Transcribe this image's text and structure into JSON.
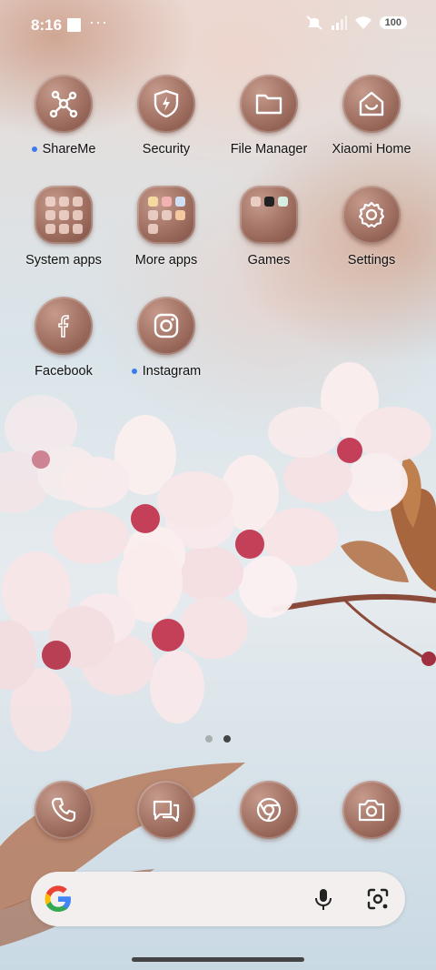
{
  "status_bar": {
    "time": "8:16",
    "more": "···",
    "battery": "100"
  },
  "apps": [
    {
      "label": "ShareMe",
      "icon": "shareme-icon",
      "new": true
    },
    {
      "label": "Security",
      "icon": "security-shield-icon",
      "new": false
    },
    {
      "label": "File Manager",
      "icon": "folder-icon",
      "new": false
    },
    {
      "label": "Xiaomi Home",
      "icon": "home-icon",
      "new": false
    },
    {
      "label": "System apps",
      "icon": "folder-grid-icon",
      "new": false
    },
    {
      "label": "More apps",
      "icon": "folder-grid-icon",
      "new": false
    },
    {
      "label": "Games",
      "icon": "folder-grid-icon",
      "new": false
    },
    {
      "label": "Settings",
      "icon": "gear-icon",
      "new": false
    },
    {
      "label": "Facebook",
      "icon": "facebook-icon",
      "new": false
    },
    {
      "label": "Instagram",
      "icon": "instagram-icon",
      "new": true
    }
  ],
  "pager": {
    "pages": 2,
    "active": 2
  },
  "dock": [
    {
      "icon": "phone-icon"
    },
    {
      "icon": "messages-icon"
    },
    {
      "icon": "chrome-icon"
    },
    {
      "icon": "camera-icon"
    }
  ],
  "search": {
    "icons": [
      "google-logo-icon",
      "mic-icon",
      "lens-icon"
    ]
  },
  "colors": {
    "icon_bg": "#9f6f61",
    "new_dot": "#3a7bf0"
  }
}
